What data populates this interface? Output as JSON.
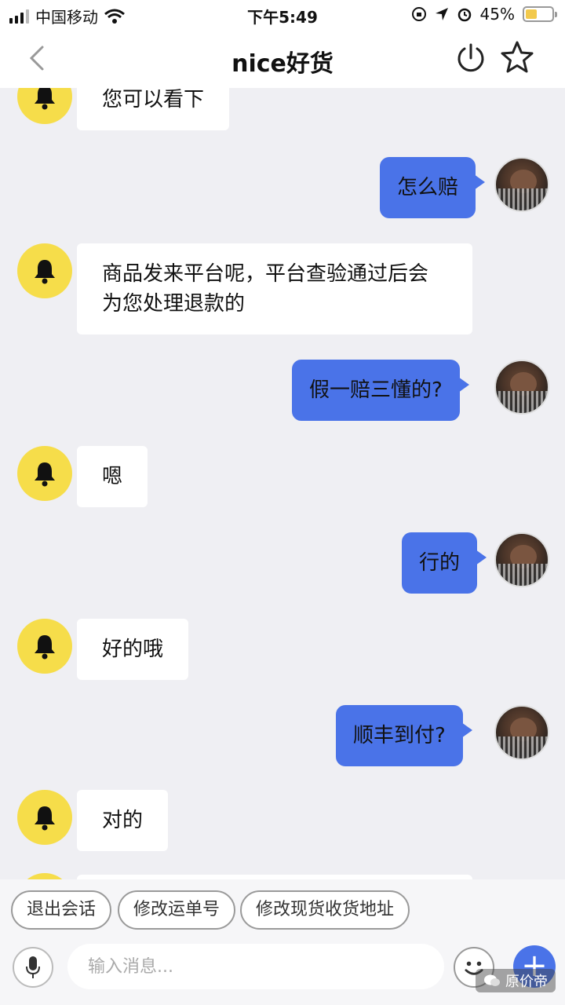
{
  "status_bar": {
    "carrier": "中国移动",
    "time": "下午5:49",
    "battery": "45%",
    "battery_level": 0.45
  },
  "nav": {
    "title": "nice好货"
  },
  "messages": [
    {
      "from": "shop",
      "text": "您可以看下"
    },
    {
      "from": "user",
      "text": "怎么赔"
    },
    {
      "from": "shop",
      "line1": "商品发来平台呢，平台查验通过后会",
      "line2": "为您处理退款的"
    },
    {
      "from": "user",
      "text": "假一赔三懂的?"
    },
    {
      "from": "shop",
      "text": "嗯"
    },
    {
      "from": "user",
      "text": "行的"
    },
    {
      "from": "shop",
      "text": "好的哦"
    },
    {
      "from": "user",
      "text": "顺丰到付?"
    },
    {
      "from": "shop",
      "text": "对的"
    }
  ],
  "quick_replies": [
    "退出会话",
    "修改运单号",
    "修改现货收货地址"
  ],
  "input": {
    "placeholder": "输入消息..."
  },
  "watermark": "原价帝",
  "colors": {
    "user_bubble": "#4a73e8",
    "shop_avatar": "#f6dd4a",
    "background": "#efeff3"
  },
  "icons": [
    "back-icon",
    "power-icon",
    "star-icon",
    "bell-icon",
    "mic-icon",
    "emoji-icon",
    "plus-icon",
    "wechat-icon"
  ]
}
